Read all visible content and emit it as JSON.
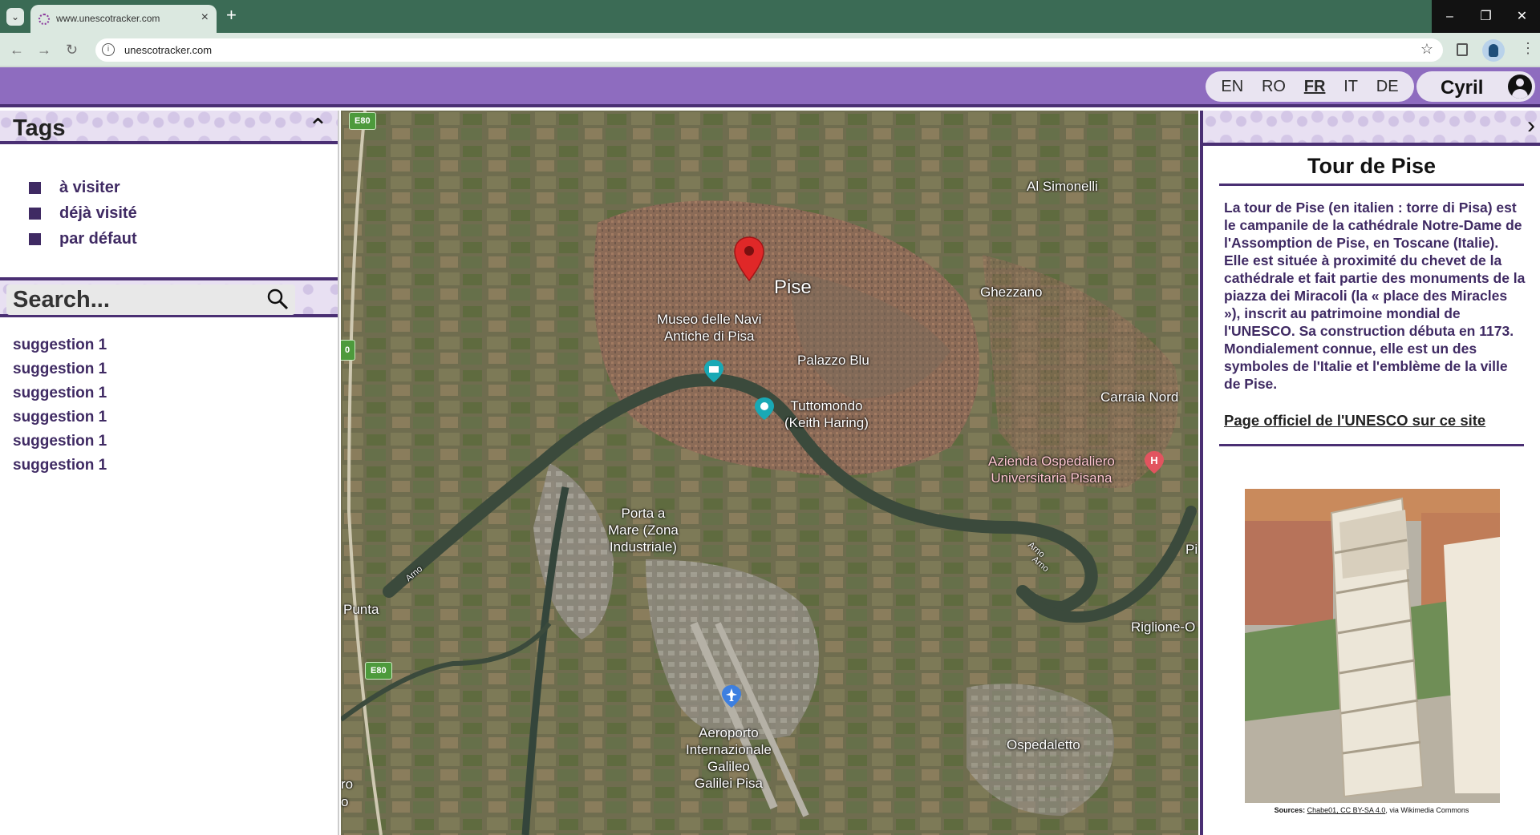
{
  "browser": {
    "tab_title": "www.unescotracker.com",
    "url": "unescotracker.com",
    "tab_close": "×",
    "new_tab": "+",
    "window_buttons": [
      "–",
      "❐",
      "✕"
    ]
  },
  "header": {
    "languages": [
      "EN",
      "RO",
      "FR",
      "IT",
      "DE"
    ],
    "active_language": "FR",
    "username": "Cyril"
  },
  "tags_panel": {
    "title": "Tags",
    "items": [
      "à visiter",
      "déjà visité",
      "par défaut"
    ]
  },
  "search": {
    "placeholder": "Search...",
    "suggestions": [
      "suggestion 1",
      "suggestion 1",
      "suggestion 1",
      "suggestion 1",
      "suggestion 1",
      "suggestion 1"
    ]
  },
  "map": {
    "labels": {
      "pise": "Pise",
      "museo_l1": "Museo delle Navi",
      "museo_l2": "Antiche di Pisa",
      "palazzo": "Palazzo Blu",
      "tutto_l1": "Tuttomondo",
      "tutto_l2": "(Keith Haring)",
      "azienda_l1": "Azienda Ospedaliero",
      "azienda_l2": "Universitaria Pisana",
      "porta_l1": "Porta a",
      "porta_l2": "Mare (Zona",
      "porta_l3": "Industriale)",
      "aero_l1": "Aeroporto",
      "aero_l2": "Internazionale",
      "aero_l3": "Galileo",
      "aero_l4": "Galilei Pisa",
      "simonelli": "Al Simonelli",
      "ghezzano": "Ghezzano",
      "carraia": "Carraia Nord",
      "riglione": "Riglione-O",
      "ospedaletto": "Ospedaletto",
      "punta": "Punta",
      "ro": "ro",
      "o": "o",
      "pi": "Pi",
      "arno1": "Arno",
      "arno2": "Arno",
      "arno3": "Arno",
      "road_e80": "E80",
      "road_e80_2": "E80",
      "road_num": "0"
    }
  },
  "site": {
    "title": "Tour de Pise",
    "description": "La tour de Pise (en italien : torre di Pisa) est le campanile de la cathédrale Notre-Dame de l'Assomption de Pise, en Toscane (Italie). Elle est située à proximité du chevet de la cathédrale et fait partie des monuments de la piazza dei Miracoli (la « place des Miracles »), inscrit au patrimoine mondial de l'UNESCO. Sa construction débuta en 1173. Mondialement connue, elle est un des symboles de l'Italie et l'emblème de la ville de Pise.",
    "link_text": "Page officiel de l'UNESCO sur ce site",
    "credit_prefix": "Sources:",
    "credit_author": "Chabe01, CC BY-SA 4.0",
    "credit_suffix": ", via Wikimedia Commons"
  },
  "colors": {
    "header_purple": "#8e6cbf",
    "dark_purple": "#4a2f73",
    "text_purple": "#3f2a63",
    "chrome_green": "#3b6b55",
    "marker_red": "#e02828"
  },
  "icons": [
    "tab-dropdown-icon",
    "close-icon",
    "plus-icon",
    "back-arrow-icon",
    "forward-arrow-icon",
    "reload-icon",
    "info-icon",
    "star-icon",
    "side-panel-icon",
    "profile-icon",
    "kebab-menu-icon",
    "user-avatar-icon",
    "chevron-up-icon",
    "search-icon",
    "chevron-right-icon",
    "location-pin-icon",
    "museum-icon",
    "camera-icon",
    "hospital-icon",
    "airport-icon"
  ]
}
